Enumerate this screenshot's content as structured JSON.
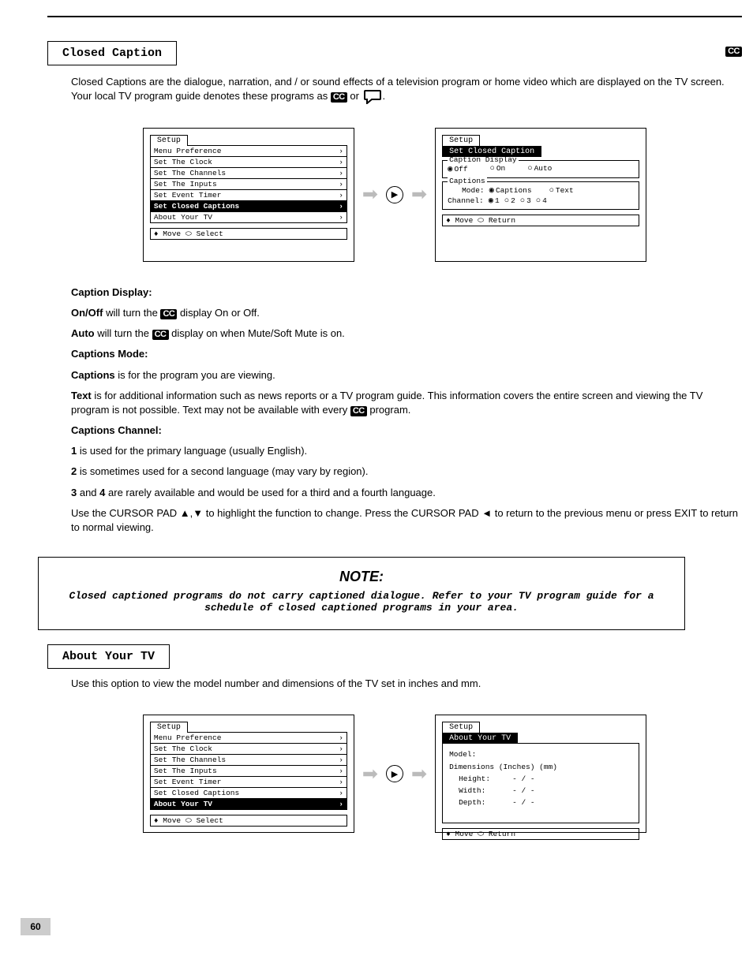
{
  "page_number": "60",
  "sec_closed": {
    "title": "Closed Caption",
    "intro": "Closed Captions are the dialogue, narration, and / or sound effects of a television program or home video which are displayed on the TV screen. Your local TV program guide denotes these programs as",
    "intro_tail": "or",
    "screen1_tab": "Setup",
    "menu_items": [
      "Menu Preference",
      "Set The Clock",
      "Set The Channels",
      "Set The Inputs",
      "Set Event Timer",
      "Set Closed Captions",
      "About Your TV"
    ],
    "menu_highlight_index": 5,
    "footer1": "♦ Move  ⬭ Select",
    "screen2_tab1": "Setup",
    "screen2_tab2": "Set Closed Caption",
    "grp1_legend": "Caption Display",
    "grp1_opts": [
      "Off",
      "On",
      "Auto"
    ],
    "grp2_legend": "Captions",
    "grp2_mode_label": "Mode:",
    "grp2_mode_opts": [
      "Captions",
      "Text"
    ],
    "grp2_chan_label": "Channel:",
    "grp2_chan_opts": [
      "1",
      "2",
      "3",
      "4"
    ],
    "footer2": "♦ Move  ⬭ Return",
    "para1": "Caption Display:",
    "para1_on": "On/Off",
    "para1_rest": "will turn the",
    "para1_rest2": "display On or Off.",
    "para1_auto": "Auto",
    "para1_auto_rest": "will turn the",
    "para1_auto_rest2": "display on when Mute/Soft Mute is on.",
    "para2": "Captions Mode:",
    "para2_cap": "Captions",
    "para2_cap_rest": "is for the program you are viewing.",
    "para2_txt": "Text",
    "para2_txt_rest1": "is for additional information such as news reports or a TV program guide. This information covers the entire screen and viewing the TV program is not possible. Text may not be available with every",
    "para2_txt_rest2": "program.",
    "para3": "Captions Channel:",
    "para3_ch1": "1",
    "para3_ch1_rest": "is used for the primary language (usually English).",
    "para3_ch2": "2",
    "para3_ch2_rest": "is sometimes used for a second language (may vary by region).",
    "para3_ch34": "3",
    "para3_ch4": "4",
    "para3_ch34_rest": "are rarely available and would be used for a third and a fourth language.",
    "para4a": "Use the CURSOR PAD",
    "para4b": "to highlight the function to change. Press the CURSOR PAD",
    "para4c": "to return to the previous menu or press EXIT to return to normal viewing.",
    "note_title": "NOTE:",
    "note_body": "Closed captioned programs do not carry captioned dialogue. Refer to your TV program guide for a schedule of closed captioned programs in your area."
  },
  "sec_about": {
    "title": "About Your TV",
    "intro": "Use this option to view the model number and dimensions of the TV set in inches and mm.",
    "screen1_tab": "Setup",
    "menu_items": [
      "Menu Preference",
      "Set The Clock",
      "Set The Channels",
      "Set The Inputs",
      "Set Event Timer",
      "Set Closed Captions",
      "About Your TV"
    ],
    "menu_highlight_index": 6,
    "footer1": "♦ Move  ⬭ Select",
    "screen2_tab1": "Setup",
    "screen2_tab2": "About Your TV",
    "fld_model": "Model:",
    "fld_dim": "Dimensions  (Inches) (mm)",
    "fld_height": "Height:",
    "fld_width": "Width:",
    "fld_depth": "Depth:",
    "val_dash": "-  /  -",
    "footer2": "♦ Move  ⬭ Return"
  }
}
